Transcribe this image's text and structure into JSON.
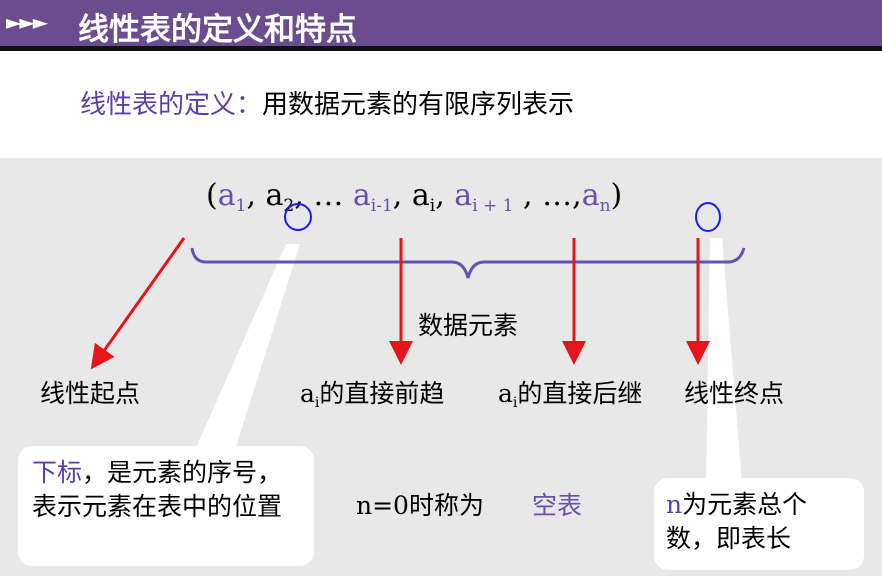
{
  "header": {
    "arrows": "►►►",
    "title": "线性表的定义和特点"
  },
  "definition": {
    "label": "线性表的定义：",
    "text": "用数据元素的有限序列表示"
  },
  "sequence": {
    "open": "(",
    "close": ")",
    "a": "a",
    "s1": "1",
    "s2": "2",
    "sim1": "i-1",
    "si": "i",
    "sip1": "i + 1",
    "sn": "n",
    "sep1": ",",
    "ellipsis1": "…",
    "ellipsis2": "…,"
  },
  "labels": {
    "data_elements": "数据元素",
    "start": "线性起点",
    "pred_a": "a",
    "pred_sub": "i",
    "pred_text": "的直接前趋",
    "succ_a": "a",
    "succ_sub": "i",
    "succ_text": "的直接后继",
    "end": "线性终点",
    "empty_prefix": "n=0",
    "empty_mid": "时称为",
    "empty_word": "空表"
  },
  "callouts": {
    "index": {
      "label": "下标",
      "text": "，是元素的序号，表示元素在表中的位置"
    },
    "count": {
      "n": "n",
      "text": "为元素总个数，即表长"
    }
  },
  "colors": {
    "header_bg": "#6b4c8f",
    "accent_purple": "#5b3fa8",
    "arrow_red": "#e8141b",
    "circle_blue": "#1a1aff",
    "panel_bg": "#e8e8e8"
  }
}
